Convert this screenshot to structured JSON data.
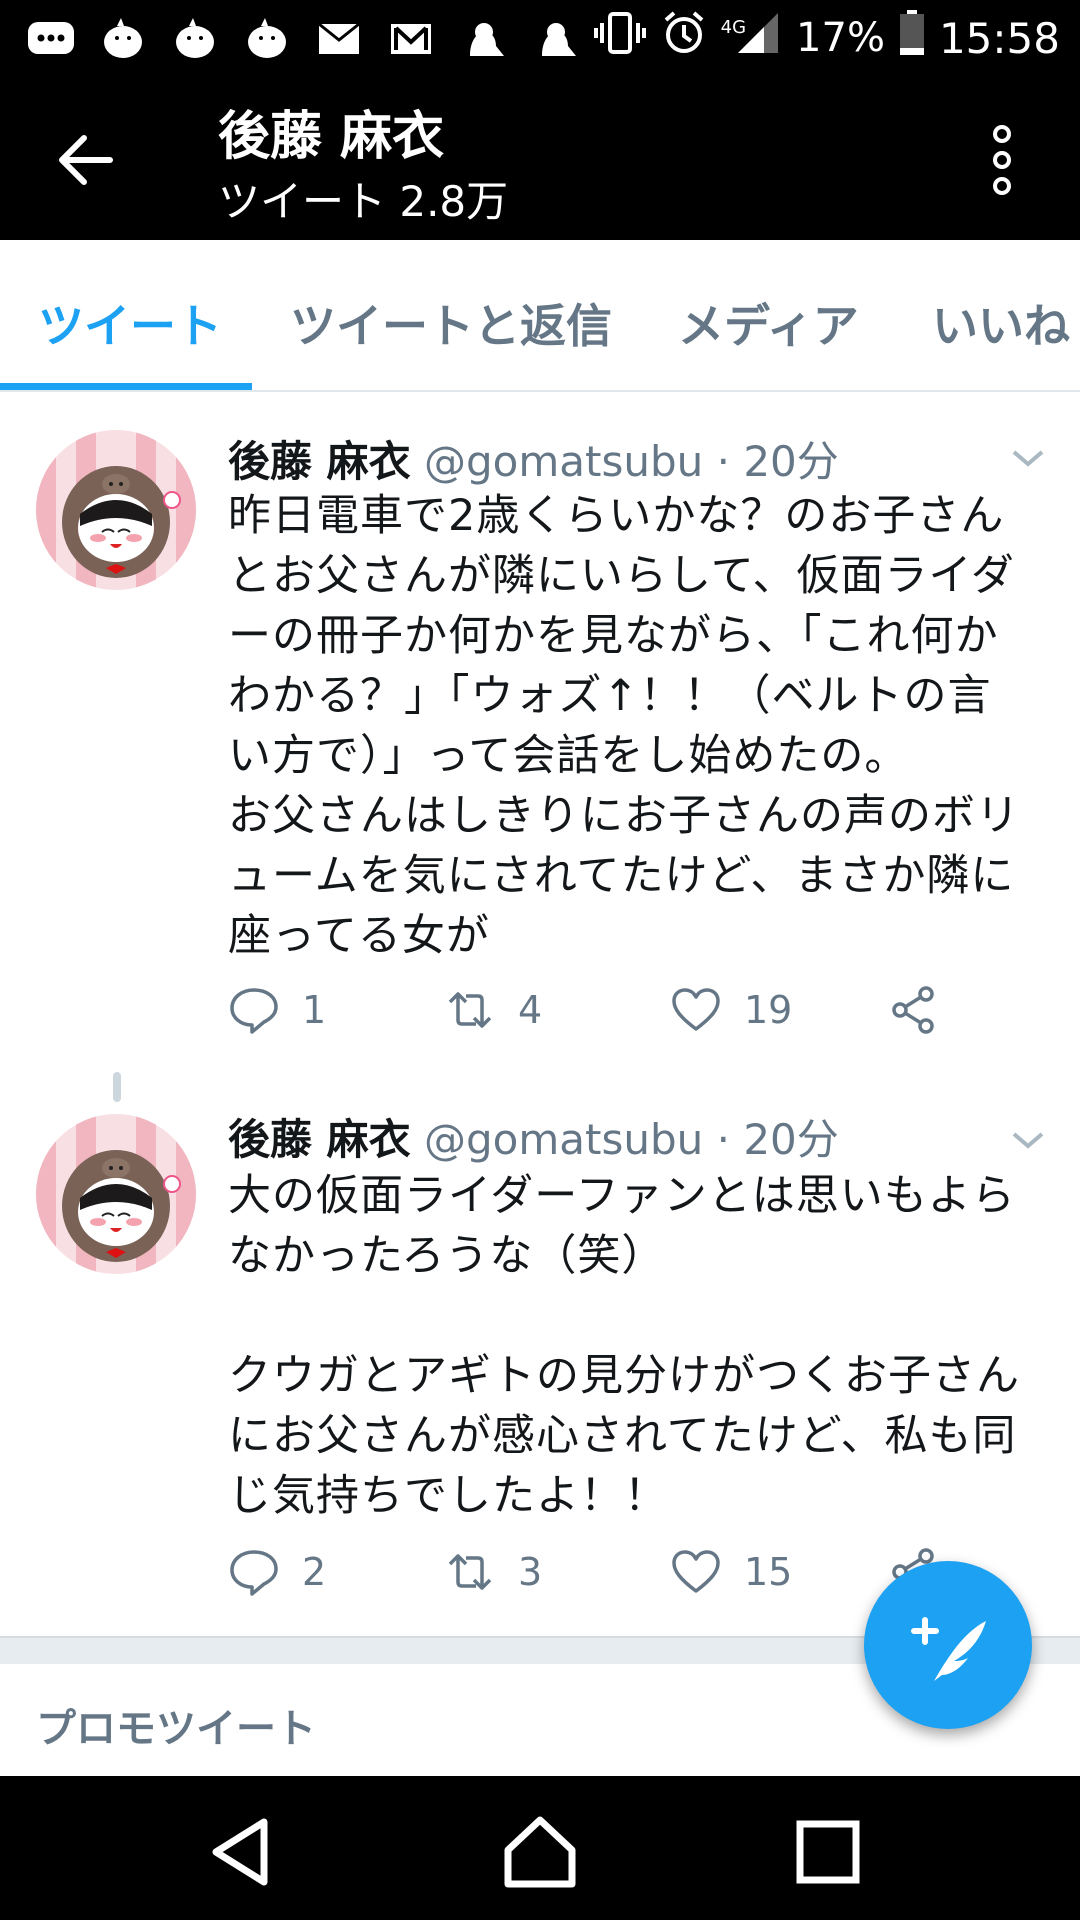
{
  "status_bar": {
    "battery": "17%",
    "time": "15:58",
    "network": "4G",
    "left_icons": [
      "message-icon",
      "chick-icon",
      "chick-icon",
      "chick-icon",
      "au-mail-icon",
      "gmail-icon",
      "ghost-icon",
      "ghost-icon"
    ],
    "right_icons": [
      "vibrate-icon",
      "alarm-icon",
      "signal-icon",
      "battery-icon"
    ]
  },
  "app_bar": {
    "title": "後藤 麻衣",
    "subtitle": "ツイート 2.8万"
  },
  "tabs": [
    {
      "label": "ツイート",
      "active": true
    },
    {
      "label": "ツイートと返信",
      "active": false
    },
    {
      "label": "メディア",
      "active": false
    },
    {
      "label": "いいね",
      "active": false
    }
  ],
  "tweets": [
    {
      "name": "後藤 麻衣",
      "handle": "@gomatsubu",
      "sep": "·",
      "time": "20分",
      "text": "昨日電車で2歳くらいかな？のお子さん\nとお父さんが隣にいらして、仮面ライダ\nーの冊子か何かを見ながら、「これ何か\nわかる？」「ウォズ↑！！（ベルトの言\nい方で）」って会話をし始めたの。\nお父さんはしきりにお子さんの声のボリ\nュームを気にされてたけど、まさか隣に\n座ってる女が",
      "replies": "1",
      "retweets": "4",
      "likes": "19"
    },
    {
      "name": "後藤 麻衣",
      "handle": "@gomatsubu",
      "sep": "·",
      "time": "20分",
      "text": "大の仮面ライダーファンとは思いもよら\nなかったろうな（笑）\n\nクウガとアギトの見分けがつくお子さん\nにお父さんが感心されてたけど、私も同\nじ気持ちでしたよ！！",
      "replies": "2",
      "retweets": "3",
      "likes": "15"
    }
  ],
  "promo_label": "プロモツイート",
  "colors": {
    "accent": "#1da1f2",
    "muted": "#657786",
    "text": "#14171a",
    "bar": "#000000"
  }
}
